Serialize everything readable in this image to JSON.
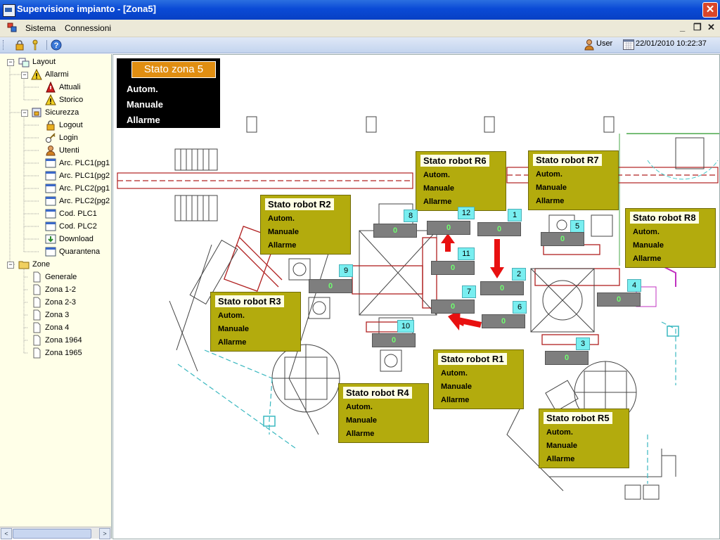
{
  "window": {
    "title": "Supervisione impianto - [Zona5]",
    "close_glyph": "✕"
  },
  "menubar": {
    "items": [
      "Sistema",
      "Connessioni"
    ],
    "minimize_glyph": "_",
    "restore_glyph": "❐",
    "close_glyph": "✕"
  },
  "toolbar": {
    "user_label": "User",
    "datetime": "22/01/2010 10:22:37"
  },
  "sidebar": {
    "items": [
      {
        "label": "Layout",
        "icon": "layout-icon"
      },
      {
        "label": "Allarmi",
        "icon": "warning-icon"
      },
      {
        "label": "Attuali",
        "icon": "bell-icon"
      },
      {
        "label": "Storico",
        "icon": "warning-icon"
      },
      {
        "label": "Sicurezza",
        "icon": "security-icon"
      },
      {
        "label": "Logout",
        "icon": "lock-icon"
      },
      {
        "label": "Login",
        "icon": "key-icon"
      },
      {
        "label": "Utenti",
        "icon": "user-icon"
      },
      {
        "label": "Arc. PLC1(pg1",
        "icon": "window-icon"
      },
      {
        "label": "Arc. PLC1(pg2",
        "icon": "window-icon"
      },
      {
        "label": "Arc. PLC2(pg1",
        "icon": "window-icon"
      },
      {
        "label": "Arc. PLC2(pg2",
        "icon": "window-icon"
      },
      {
        "label": "Cod. PLC1",
        "icon": "window-icon"
      },
      {
        "label": "Cod. PLC2",
        "icon": "window-icon"
      },
      {
        "label": "Download",
        "icon": "download-icon"
      },
      {
        "label": "Quarantena",
        "icon": "window-icon"
      },
      {
        "label": "Zone",
        "icon": "folder-icon"
      },
      {
        "label": "Generale",
        "icon": "page-icon"
      },
      {
        "label": "Zona 1-2",
        "icon": "page-icon"
      },
      {
        "label": "Zona 2-3",
        "icon": "page-icon"
      },
      {
        "label": "Zona 3",
        "icon": "page-icon"
      },
      {
        "label": "Zona 4",
        "icon": "page-icon"
      },
      {
        "label": "Zona 1964",
        "icon": "page-icon"
      },
      {
        "label": "Zona 1965",
        "icon": "page-icon"
      }
    ],
    "expand_glyph": "−",
    "scroll_left": "<",
    "scroll_right": ">"
  },
  "zone": {
    "title": "Stato zona 5",
    "lines": [
      "Autom.",
      "Manuale",
      "Allarme"
    ]
  },
  "robots": [
    {
      "title": "Stato robot R6",
      "lines": [
        "Autom.",
        "Manuale",
        "Allarme"
      ]
    },
    {
      "title": "Stato robot R7",
      "lines": [
        "Autom.",
        "Manuale",
        "Allarme"
      ]
    },
    {
      "title": "Stato robot R2",
      "lines": [
        "Autom.",
        "Manuale",
        "Allarme"
      ]
    },
    {
      "title": "Stato robot R8",
      "lines": [
        "Autom.",
        "Manuale",
        "Allarme"
      ]
    },
    {
      "title": "Stato robot R3",
      "lines": [
        "Autom.",
        "Manuale",
        "Allarme"
      ]
    },
    {
      "title": "Stato robot R1",
      "lines": [
        "Autom.",
        "Manuale",
        "Allarme"
      ]
    },
    {
      "title": "Stato robot R4",
      "lines": [
        "Autom.",
        "Manuale",
        "Allarme"
      ]
    },
    {
      "title": "Stato robot R5",
      "lines": [
        "Autom.",
        "Manuale",
        "Allarme"
      ]
    }
  ],
  "stations": [
    {
      "label": "8",
      "value": "0"
    },
    {
      "label": "12",
      "value": "0"
    },
    {
      "label": "1",
      "value": "0"
    },
    {
      "label": "5",
      "value": "0"
    },
    {
      "label": "11",
      "value": "0"
    },
    {
      "label": "9",
      "value": "0"
    },
    {
      "label": "2",
      "value": "0"
    },
    {
      "label": "4",
      "value": "0"
    },
    {
      "label": "7",
      "value": "0"
    },
    {
      "label": "6",
      "value": "0"
    },
    {
      "label": "10",
      "value": "0"
    },
    {
      "label": "3",
      "value": "0"
    }
  ],
  "colors": {
    "robot_box": "#b3ab0d",
    "zone_title": "#e08e12",
    "counter_bg": "#7e7e7e",
    "counter_text": "#6fff6f",
    "station_label": "#78eef0",
    "arrow": "#e81010",
    "conveyor": "#b02020"
  }
}
